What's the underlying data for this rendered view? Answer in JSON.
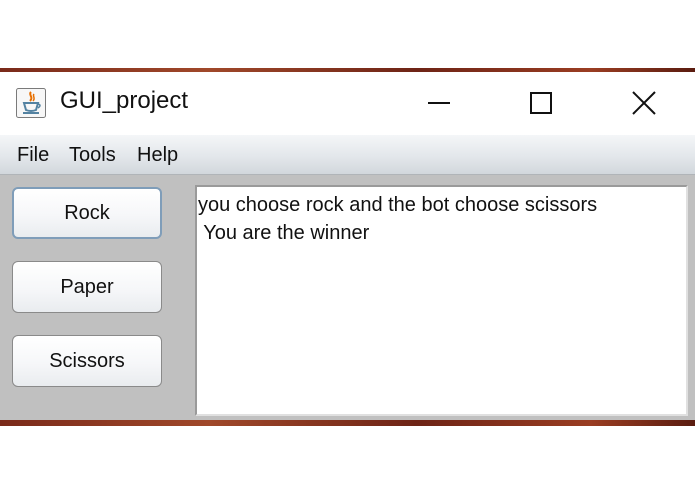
{
  "window": {
    "title": "GUI_project",
    "icon": "java-cup-icon"
  },
  "controls": {
    "minimize": "minimize-icon",
    "maximize": "maximize-icon",
    "close": "close-icon"
  },
  "menu": {
    "file": "File",
    "tools": "Tools",
    "help": "Help"
  },
  "buttons": {
    "rock": "Rock",
    "paper": "Paper",
    "scissors": "Scissors"
  },
  "output": {
    "lines": [
      "you choose rock and the bot choose scissors",
      " You are the winner"
    ]
  },
  "colors": {
    "window_bg": "#c0c0c0",
    "focus_border": "#7f9db9",
    "java_orange": "#e76f00",
    "java_blue": "#5382a1"
  }
}
